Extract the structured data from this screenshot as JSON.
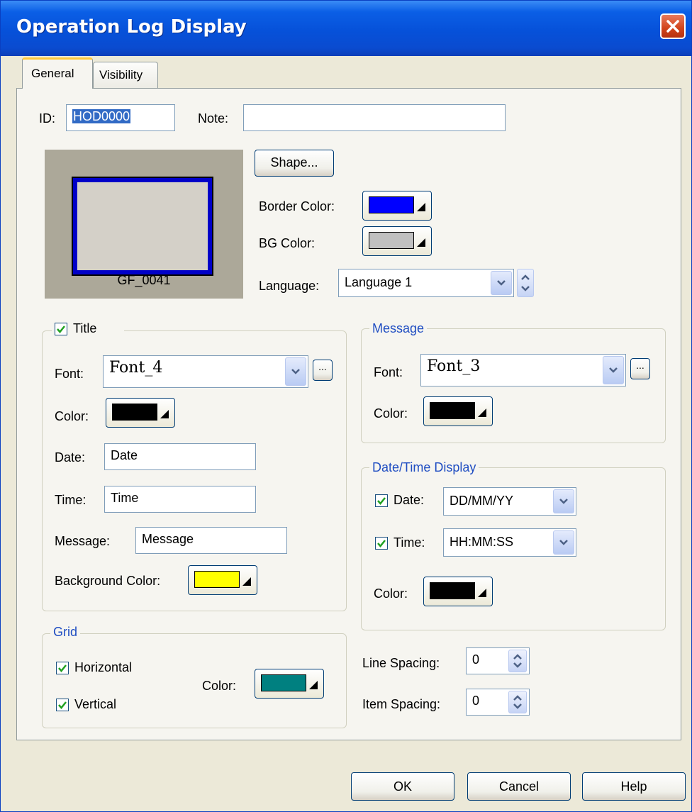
{
  "window": {
    "title": "Operation Log Display"
  },
  "tabs": [
    {
      "label": "General"
    },
    {
      "label": "Visibility"
    }
  ],
  "general": {
    "id_label": "ID:",
    "id_value": "HOD0000",
    "note_label": "Note:",
    "note_value": "",
    "shape_button": "Shape...",
    "preview_name": "GF_0041",
    "border_color_label": "Border Color:",
    "border_color": "#0000ff",
    "bg_color_label": "BG Color:",
    "bg_color": "#c0c0c0",
    "language_label": "Language:",
    "language_value": "Language 1"
  },
  "title_group": {
    "label": "Title",
    "checked": true,
    "font_label": "Font:",
    "font_value": "Font_4",
    "font_more": "...",
    "color_label": "Color:",
    "color": "#000000",
    "date_label": "Date:",
    "date_value": "Date",
    "time_label": "Time:",
    "time_value": "Time",
    "message_label": "Message:",
    "message_value": "Message",
    "bg_color_label": "Background Color:",
    "bg_color": "#ffff00"
  },
  "message_group": {
    "label": "Message",
    "font_label": "Font:",
    "font_value": "Font_3",
    "font_more": "...",
    "color_label": "Color:",
    "color": "#000000"
  },
  "datetime_group": {
    "label": "Date/Time Display",
    "date_label": "Date:",
    "date_checked": true,
    "date_format": "DD/MM/YY",
    "time_label": "Time:",
    "time_checked": true,
    "time_format": "HH:MM:SS",
    "color_label": "Color:",
    "color": "#000000"
  },
  "grid_group": {
    "label": "Grid",
    "horizontal_label": "Horizontal",
    "horizontal_checked": true,
    "vertical_label": "Vertical",
    "vertical_checked": true,
    "color_label": "Color:",
    "color": "#008080"
  },
  "spacing": {
    "line_label": "Line Spacing:",
    "line_value": "0",
    "item_label": "Item Spacing:",
    "item_value": "0"
  },
  "buttons": {
    "ok": "OK",
    "cancel": "Cancel",
    "help": "Help"
  }
}
